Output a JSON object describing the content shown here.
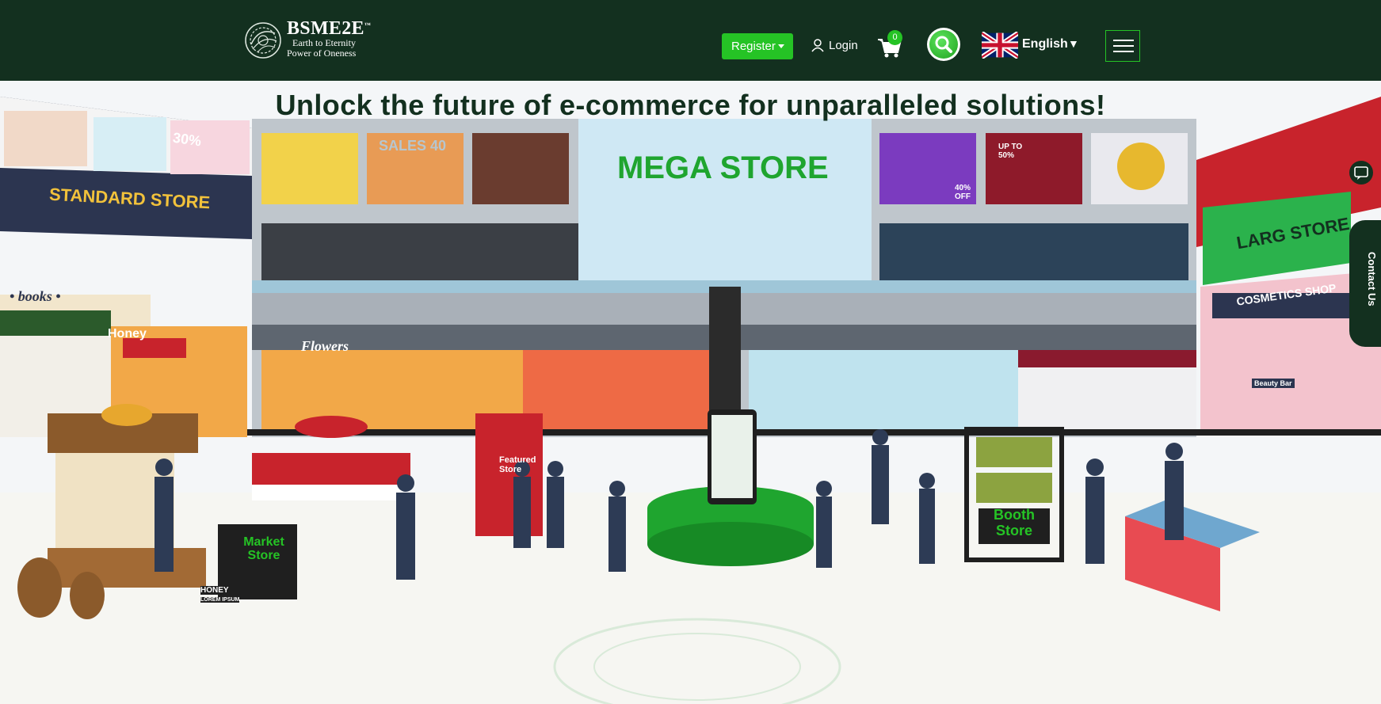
{
  "brand": {
    "name": "BSME2E",
    "trademark": "™",
    "tagline_1": "Earth to Eternity",
    "tagline_2": "Power of Oneness"
  },
  "header": {
    "register_label": "Register",
    "login_label": "Login",
    "cart_count": "0",
    "language_label": "English"
  },
  "hero": {
    "headline": "Unlock the future of e-commerce for unparalleled solutions!",
    "signs": {
      "mega_store": "MEGA STORE",
      "standard_store": "STANDARD STORE",
      "large_store": "LARG STORE",
      "cosmetics_shop": "COSMETICS SHOP",
      "books": "• books •",
      "honey": "Honey",
      "flowers": "Flowers",
      "market_store": "Market Store",
      "booth_store": "Booth Store",
      "featured_store": "Featured Store",
      "sale_30": "30%",
      "sale_40": "SALES 40",
      "upto_50": "UP TO 50%",
      "off_40": "40% OFF",
      "beauty_bar": "Beauty Bar",
      "honey_board": "HONEY",
      "lorem": "LOREM IPSUM"
    }
  },
  "side_widgets": {
    "contact_label": "Contact Us"
  },
  "colors": {
    "header_bg": "#13301f",
    "accent_green": "#25c325",
    "headline_text": "#13301f"
  },
  "icons": [
    "logo-mark-icon",
    "caret-down-icon",
    "user-icon",
    "cart-icon",
    "search-icon",
    "uk-flag-icon",
    "hamburger-menu-icon",
    "chat-icon"
  ]
}
